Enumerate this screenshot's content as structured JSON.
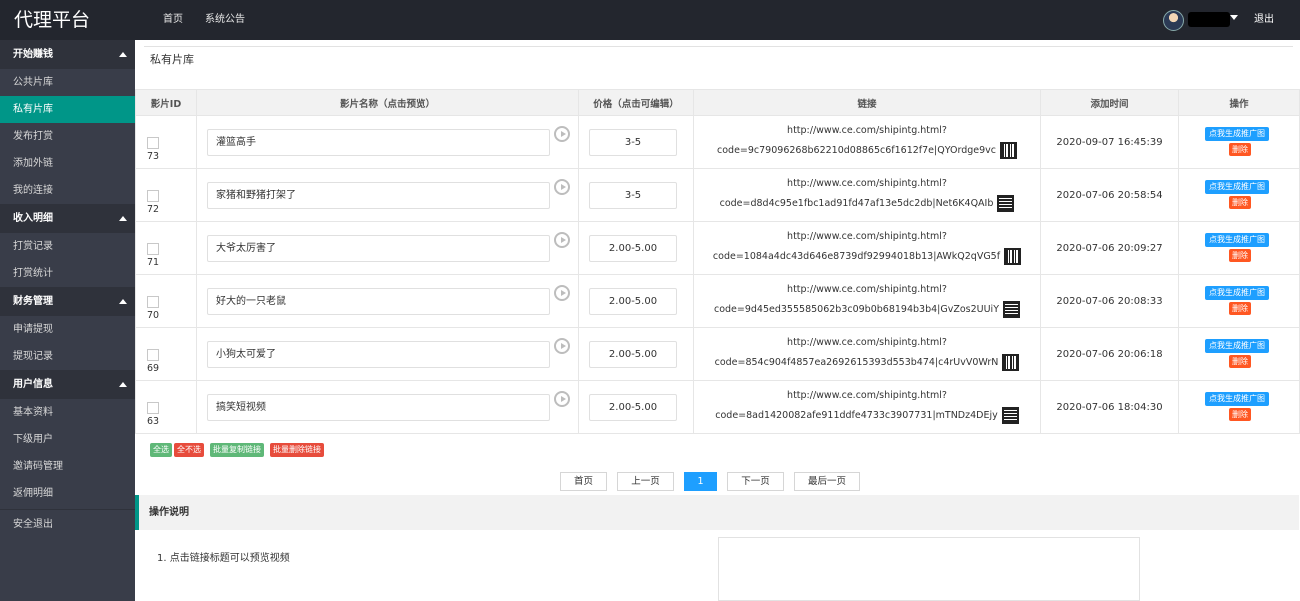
{
  "header": {
    "logo": "代理平台",
    "nav": [
      "首页",
      "系统公告"
    ],
    "logout": "退出"
  },
  "sidebar": {
    "groups": [
      {
        "title": "开始赚钱",
        "items": [
          "公共片库",
          "私有片库",
          "发布打赏",
          "添加外链",
          "我的连接"
        ]
      },
      {
        "title": "收入明细",
        "items": [
          "打赏记录",
          "打赏统计"
        ]
      },
      {
        "title": "财务管理",
        "items": [
          "申请提现",
          "提现记录"
        ]
      },
      {
        "title": "用户信息",
        "items": [
          "基本资料",
          "下级用户",
          "邀请码管理",
          "返佣明细"
        ]
      }
    ],
    "active_item": "私有片库",
    "logout": "安全退出"
  },
  "page": {
    "legend": "私有片库"
  },
  "table": {
    "headers": [
      "影片ID",
      "影片名称（点击预览）",
      "价格（点击可编辑）",
      "链接",
      "添加时间",
      "操作"
    ],
    "rows": [
      {
        "id": "73",
        "name": "灌篮高手",
        "price": "3-5",
        "url": "http://www.ce.com/shipintg.html?",
        "code": "code=9c79096268b62210d08865c6f1612f7e|QYOrdge9vc",
        "time": "2020-09-07 16:45:39"
      },
      {
        "id": "72",
        "name": "家猪和野猪打架了",
        "price": "3-5",
        "url": "http://www.ce.com/shipintg.html?",
        "code": "code=d8d4c95e1fbc1ad91fd47af13e5dc2db|Net6K4QAIb",
        "time": "2020-07-06 20:58:54"
      },
      {
        "id": "71",
        "name": "大爷太厉害了",
        "price": "2.00-5.00",
        "url": "http://www.ce.com/shipintg.html?",
        "code": "code=1084a4dc43d646e8739df92994018b13|AWkQ2qVG5f",
        "time": "2020-07-06 20:09:27"
      },
      {
        "id": "70",
        "name": "好大的一只老鼠",
        "price": "2.00-5.00",
        "url": "http://www.ce.com/shipintg.html?",
        "code": "code=9d45ed355585062b3c09b0b68194b3b4|GvZos2UUiY",
        "time": "2020-07-06 20:08:33"
      },
      {
        "id": "69",
        "name": "小狗太可爱了",
        "price": "2.00-5.00",
        "url": "http://www.ce.com/shipintg.html?",
        "code": "code=854c904f4857ea2692615393d553b474|c4rUvV0WrN",
        "time": "2020-07-06 20:06:18"
      },
      {
        "id": "63",
        "name": "搞笑短视频",
        "price": "2.00-5.00",
        "url": "http://www.ce.com/shipintg.html?",
        "code": "code=8ad1420082afe911ddfe4733c3907731|mTNDz4DEjy",
        "time": "2020-07-06 18:04:30"
      }
    ],
    "gen_label": "点我生成推广图",
    "del_label": "删除"
  },
  "batch": {
    "select_all": "全选",
    "select_none": "全不选",
    "copy_links": "批量复制链接",
    "delete_links": "批量删除链接"
  },
  "pager": {
    "first": "首页",
    "prev": "上一页",
    "current": "1",
    "next": "下一页",
    "last": "最后一页"
  },
  "notice": {
    "title": "操作说明",
    "tip": "1. 点击链接标题可以预览视频"
  },
  "colors": {
    "header_bg": "#23262e",
    "sidebar_bg": "#393d49",
    "active": "#009688",
    "primary": "#1e9fff",
    "danger": "#ff5722"
  }
}
